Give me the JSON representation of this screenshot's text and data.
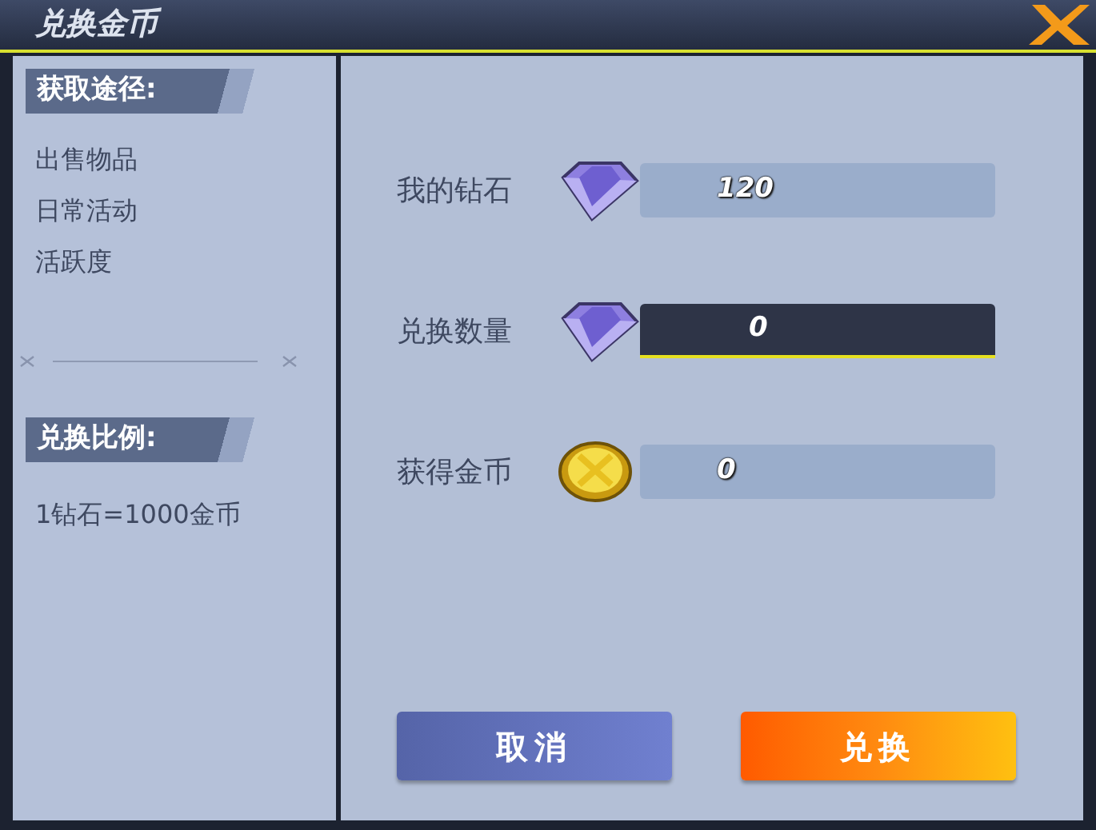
{
  "window": {
    "title": "兑换金币"
  },
  "sidebar": {
    "sections": [
      {
        "heading": "获取途径:",
        "items": [
          "出售物品",
          "日常活动",
          "活跃度"
        ]
      },
      {
        "heading": "兑换比例:",
        "items": [
          "1钻石=1000金币"
        ]
      }
    ]
  },
  "rows": [
    {
      "label": "我的钻石",
      "kind": "diamond",
      "value": "120",
      "focused": false
    },
    {
      "label": "兑换数量",
      "kind": "diamond",
      "value": "0",
      "focused": true
    },
    {
      "label": "获得金币",
      "kind": "coin",
      "value": "0",
      "focused": false
    }
  ],
  "buttons": [
    {
      "label": "取消",
      "kind": "secondary"
    },
    {
      "label": "兑换",
      "kind": "primary"
    }
  ]
}
